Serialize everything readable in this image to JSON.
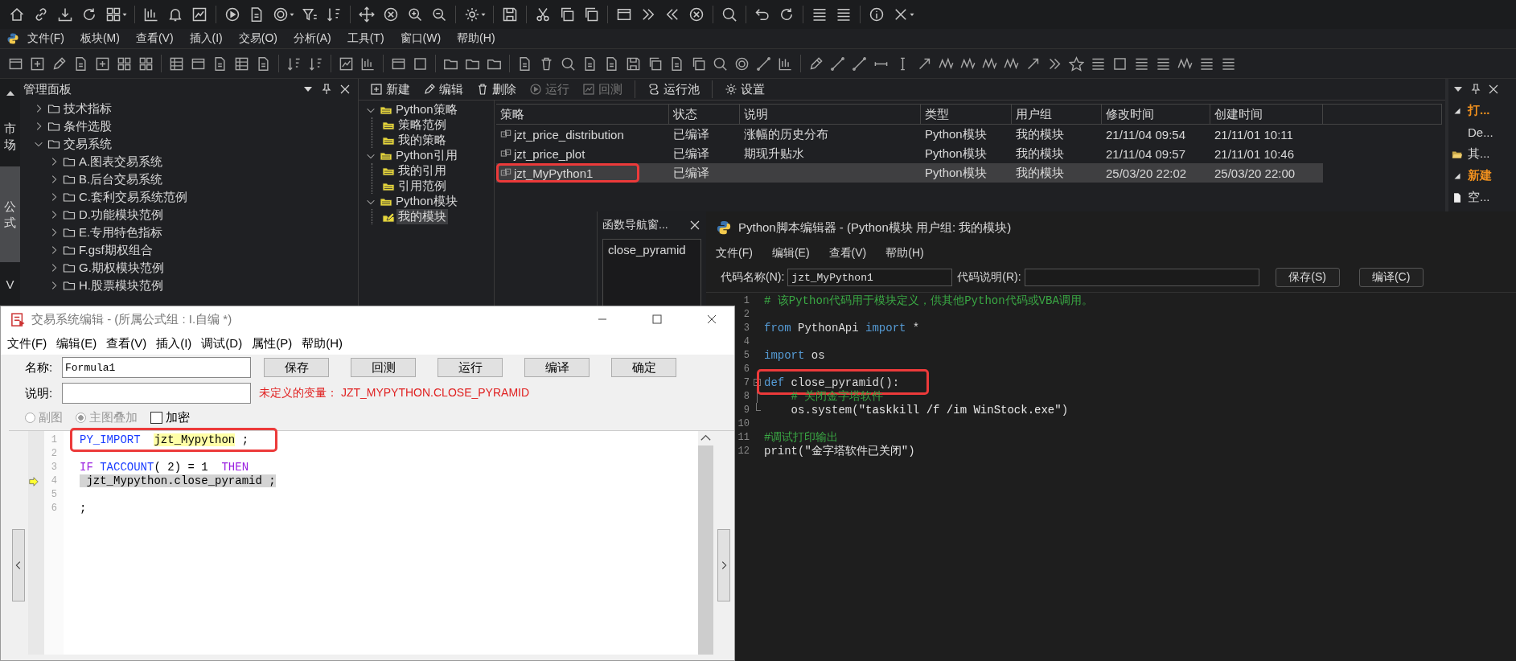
{
  "menu_bar": [
    "文件(F)",
    "板块(M)",
    "查看(V)",
    "插入(I)",
    "交易(O)",
    "分析(A)",
    "工具(T)",
    "窗口(W)",
    "帮助(H)"
  ],
  "side_tabs": [
    {
      "label": "市场",
      "selected": false
    },
    {
      "label": "公式",
      "selected": true
    },
    {
      "label": "V",
      "selected": false
    }
  ],
  "manage_panel": {
    "title": "管理面板",
    "tree": [
      {
        "label": "技术指标",
        "expanded": false
      },
      {
        "label": "条件选股",
        "expanded": false
      },
      {
        "label": "交易系统",
        "expanded": true,
        "children": [
          {
            "label": "A.图表交易系统",
            "expanded": false
          },
          {
            "label": "B.后台交易系统",
            "expanded": false
          },
          {
            "label": "C.套利交易系统范例",
            "expanded": false
          },
          {
            "label": "D.功能模块范例",
            "expanded": false
          },
          {
            "label": "E.专用特色指标",
            "expanded": false
          },
          {
            "label": "F.gsf期权组合",
            "expanded": false
          },
          {
            "label": "G.期权模块范例",
            "expanded": false
          },
          {
            "label": "H.股票模块范例",
            "expanded": false
          }
        ]
      }
    ]
  },
  "strategy_toolbar": [
    {
      "label": "新建",
      "disabled": false
    },
    {
      "label": "编辑",
      "disabled": false
    },
    {
      "label": "删除",
      "disabled": false
    },
    {
      "label": "运行",
      "disabled": true
    },
    {
      "label": "回测",
      "disabled": true
    },
    {
      "label": "运行池",
      "disabled": false
    },
    {
      "label": "设置",
      "disabled": false
    }
  ],
  "strategy_tree": [
    {
      "label": "Python策略",
      "expanded": true,
      "children": [
        {
          "label": "策略范例",
          "selected": false
        },
        {
          "label": "我的策略",
          "selected": false
        }
      ]
    },
    {
      "label": "Python引用",
      "expanded": true,
      "children": [
        {
          "label": "我的引用",
          "selected": false
        },
        {
          "label": "引用范例",
          "selected": false
        }
      ]
    },
    {
      "label": "Python模块",
      "expanded": true,
      "children": [
        {
          "label": "我的模块",
          "selected": true
        }
      ]
    }
  ],
  "table": {
    "columns": [
      "策略",
      "状态",
      "说明",
      "类型",
      "用户组",
      "修改时间",
      "创建时间"
    ],
    "rows": [
      {
        "cells": [
          "jzt_price_distribution",
          "已编译",
          "涨幅的历史分布",
          "Python模块",
          "我的模块",
          "21/11/04 09:54",
          "21/11/01 10:11"
        ],
        "selected": false,
        "highlighted": false
      },
      {
        "cells": [
          "jzt_price_plot",
          "已编译",
          "期现升贴水",
          "Python模块",
          "我的模块",
          "21/11/04 09:57",
          "21/11/01 10:46"
        ],
        "selected": false,
        "highlighted": false
      },
      {
        "cells": [
          "jzt_MyPython1",
          "已编译",
          "",
          "Python模块",
          "我的模块",
          "25/03/20 22:02",
          "25/03/20 22:00"
        ],
        "selected": true,
        "highlighted": true
      }
    ]
  },
  "right_panel": {
    "items": [
      {
        "label": "打...",
        "kind": "group"
      },
      {
        "label": "De...",
        "kind": "item"
      },
      {
        "label": "其...",
        "kind": "folder"
      },
      {
        "label": "新建",
        "kind": "group"
      },
      {
        "label": "空...",
        "kind": "file"
      }
    ]
  },
  "function_navigator": {
    "title": "函数导航窗...",
    "items": [
      "close_pyramid"
    ]
  },
  "python_editor": {
    "title": "Python脚本编辑器 - (Python模块 用户组: 我的模块)",
    "menu": [
      "文件(F)",
      "编辑(E)",
      "查看(V)",
      "帮助(H)"
    ],
    "name_label": "代码名称(N):",
    "name_value": "jzt_MyPython1",
    "desc_label": "代码说明(R):",
    "buttons": [
      "保存(S)",
      "编译(C)"
    ],
    "lines": [
      {
        "number": "1",
        "tokens": [
          {
            "text": "# 该Python代码用于模块定义，供其他Python代码或VBA调用。",
            "kind": "comment"
          }
        ],
        "highlighted": false
      },
      {
        "number": "2",
        "highlighted": false
      },
      {
        "number": "3",
        "tokens": [
          {
            "text": "from",
            "kind": "keyword"
          },
          {
            "text": " PythonApi ",
            "kind": "plain"
          },
          {
            "text": "import",
            "kind": "keyword"
          },
          {
            "text": " *",
            "kind": "plain"
          }
        ],
        "highlighted": false
      },
      {
        "number": "4",
        "highlighted": false
      },
      {
        "number": "5",
        "tokens": [
          {
            "text": "import",
            "kind": "keyword"
          },
          {
            "text": " os",
            "kind": "plain"
          }
        ],
        "highlighted": false
      },
      {
        "number": "6",
        "highlighted": false
      },
      {
        "number": "7",
        "tokens": [
          {
            "text": "def",
            "kind": "keyword"
          },
          {
            "text": " close_pyramid():",
            "kind": "plain"
          }
        ],
        "highlighted": true,
        "kind": "fold_start"
      },
      {
        "number": "8",
        "tokens": [
          {
            "text": "    # 关闭金字塔软件",
            "kind": "comment"
          }
        ],
        "highlighted": false,
        "kind": "fold_body"
      },
      {
        "number": "9",
        "tokens": [
          {
            "text": "    os.system(",
            "kind": "plain"
          },
          {
            "text": "\"taskkill /f /im WinStock.exe\"",
            "kind": "string"
          },
          {
            "text": ")",
            "kind": "plain"
          }
        ],
        "highlighted": false,
        "kind": "fold_end"
      },
      {
        "number": "10",
        "highlighted": false
      },
      {
        "number": "11",
        "tokens": [
          {
            "text": "#调试打印输出",
            "kind": "comment"
          }
        ],
        "highlighted": false
      },
      {
        "number": "12",
        "tokens": [
          {
            "text": "print(",
            "kind": "plain"
          },
          {
            "text": "\"金字塔软件已关闭\"",
            "kind": "string"
          },
          {
            "text": ")",
            "kind": "plain"
          }
        ],
        "highlighted": false
      }
    ]
  },
  "trade_dialog": {
    "title": "交易系统编辑 - (所属公式组 : I.自编 *)",
    "menu": [
      "文件(F)",
      "编辑(E)",
      "查看(V)",
      "插入(I)",
      "调试(D)",
      "属性(P)",
      "帮助(H)"
    ],
    "name_label": "名称:",
    "name_value": "Formula1",
    "buttons": [
      "保存",
      "回测",
      "运行",
      "编译",
      "确定"
    ],
    "desc_label": "说明:",
    "error": "未定义的变量： JZT_MYPYTHON.CLOSE_PYRAMID",
    "options": [
      {
        "kind": "radio",
        "label": "副图",
        "checked": false,
        "disabled": true
      },
      {
        "kind": "radio",
        "label": "主图叠加",
        "checked": true,
        "disabled": true
      },
      {
        "kind": "checkbox",
        "label": "加密",
        "checked": false,
        "disabled": false
      }
    ],
    "lines": [
      {
        "number": "1",
        "tokens": [
          {
            "text": "PY_IMPORT  ",
            "kind": "keyword"
          },
          {
            "text": "jzt_Mypython",
            "kind": "mark"
          },
          {
            "text": " ;",
            "kind": "plain"
          }
        ],
        "highlighted": true,
        "current": false
      },
      {
        "number": "2",
        "highlighted": false,
        "current": false
      },
      {
        "number": "3",
        "tokens": [
          {
            "text": "IF",
            "kind": "purple"
          },
          {
            "text": " TACCOUNT",
            "kind": "keyword"
          },
          {
            "text": "( 2) = 1  ",
            "kind": "plain"
          },
          {
            "text": "THEN",
            "kind": "purple"
          }
        ],
        "highlighted": false,
        "current": false
      },
      {
        "number": "4",
        "tokens": [
          {
            "text": " jzt_Mypython.close_pyramid ;",
            "kind": "plain"
          }
        ],
        "highlighted": false,
        "current": true
      },
      {
        "number": "5",
        "highlighted": false,
        "current": false
      },
      {
        "number": "6",
        "tokens": [
          {
            "text": ";",
            "kind": "plain"
          }
        ],
        "highlighted": false,
        "current": false
      }
    ]
  }
}
